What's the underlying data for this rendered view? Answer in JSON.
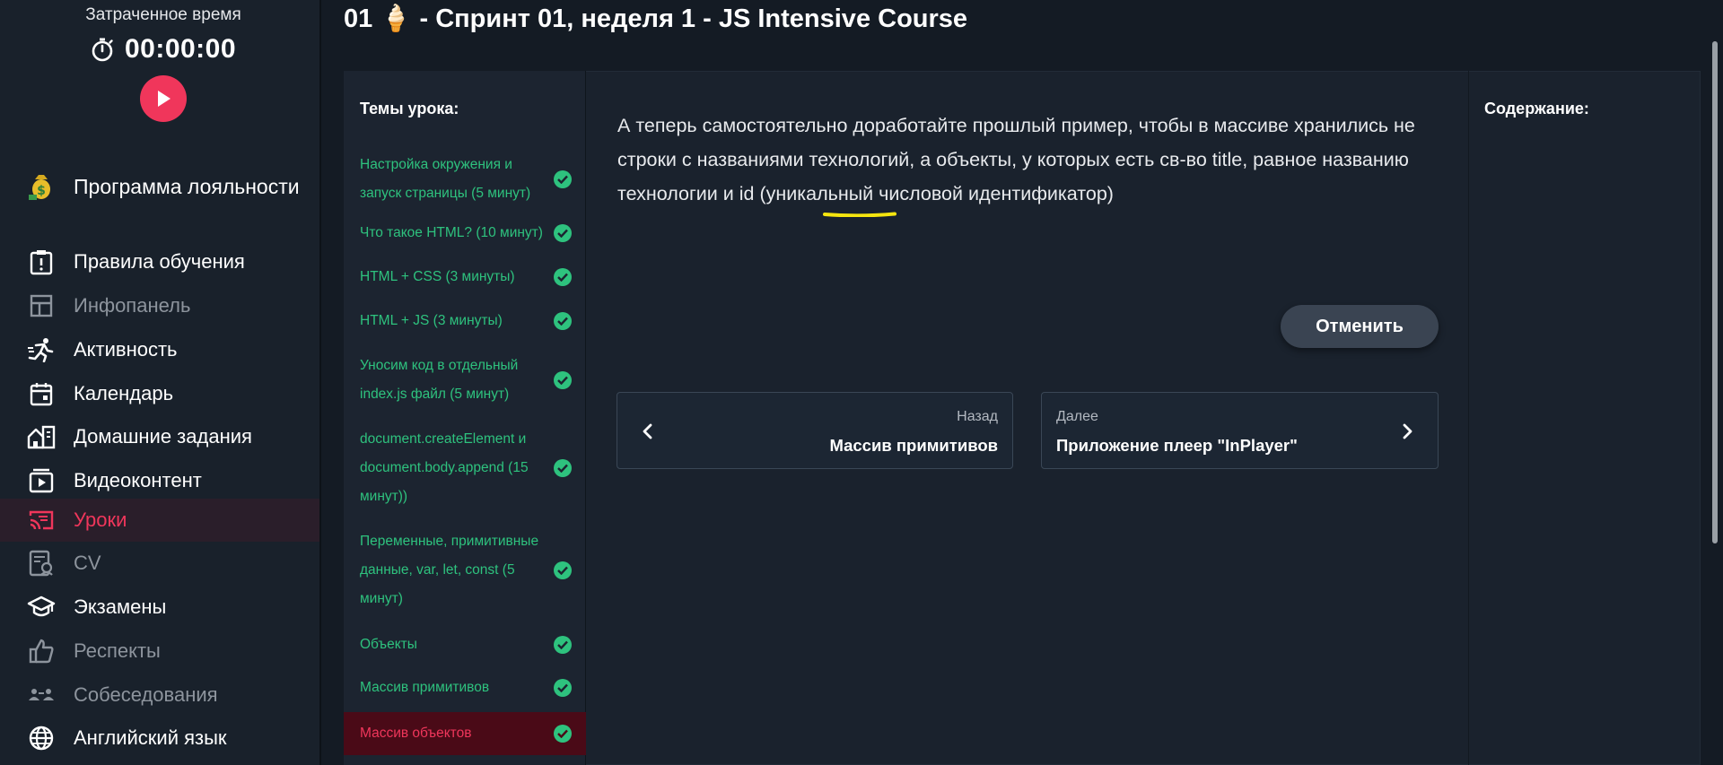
{
  "timer": {
    "title": "Затраченное время",
    "value": "00:00:00"
  },
  "sidebar": {
    "loyalty": "Программа лояльности",
    "items": [
      {
        "label": "Правила обучения",
        "icon": "info-clipboard-icon",
        "state": "normal"
      },
      {
        "label": "Инфопанель",
        "icon": "dashboard-icon",
        "state": "muted"
      },
      {
        "label": "Активность",
        "icon": "running-icon",
        "state": "normal"
      },
      {
        "label": "Календарь",
        "icon": "calendar-icon",
        "state": "normal"
      },
      {
        "label": "Домашние задания",
        "icon": "home-tasks-icon",
        "state": "normal"
      },
      {
        "label": "Видеоконтент",
        "icon": "video-icon",
        "state": "normal"
      },
      {
        "label": "Уроки",
        "icon": "cast-icon",
        "state": "active"
      },
      {
        "label": "CV",
        "icon": "cv-icon",
        "state": "muted"
      },
      {
        "label": "Экзамены",
        "icon": "graduation-cap-icon",
        "state": "normal"
      },
      {
        "label": "Респекты",
        "icon": "thumbs-up-icon",
        "state": "muted"
      },
      {
        "label": "Собеседования",
        "icon": "people-icon",
        "state": "muted"
      },
      {
        "label": "Английский язык",
        "icon": "globe-icon",
        "state": "normal"
      }
    ]
  },
  "page": {
    "title": "01 🍦 - Спринт 01, неделя 1 - JS Intensive Course"
  },
  "topics": {
    "title": "Темы урока:",
    "items": [
      {
        "label": "Настройка окружения и запуск страницы (5 минут)",
        "done": true
      },
      {
        "label": "Что такое HTML? (10 минут)",
        "done": true
      },
      {
        "label": "HTML + CSS (3 минуты)",
        "done": true
      },
      {
        "label": "HTML + JS (3 минуты)",
        "done": true
      },
      {
        "label": "Уносим код в отдельный index.js файл (5 минут)",
        "done": true
      },
      {
        "label": "document.createElement и document.body.append (15 минут))",
        "done": true
      },
      {
        "label": "Переменные, примитивные данные, var, let, const (5 минут)",
        "done": true
      },
      {
        "label": "Объекты",
        "done": true
      },
      {
        "label": "Массив примитивов",
        "done": true
      },
      {
        "label": "Массив объектов",
        "done": true,
        "current": true
      }
    ]
  },
  "lesson": {
    "text": "А теперь самостоятельно доработайте прошлый пример, чтобы в массиве хранились не строки с названиями технологий, а объекты, у которых есть св-во title, равное названию технологии и id (уникальный числовой идентификатор)"
  },
  "actions": {
    "cancel": "Отменить"
  },
  "navigation": {
    "back_label": "Назад",
    "back_title": "Массив примитивов",
    "next_label": "Далее",
    "next_title": "Приложение плеер \"InPlayer\""
  },
  "toc": {
    "title": "Содержание:"
  },
  "colors": {
    "accent": "#f0365b",
    "done": "#2ec27e",
    "background": "#141b24"
  }
}
